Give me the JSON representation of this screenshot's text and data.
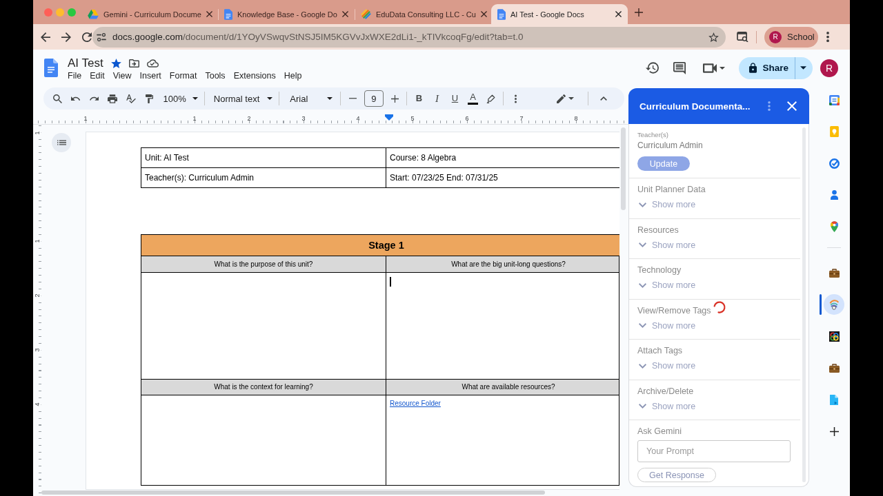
{
  "browser": {
    "tabs": [
      {
        "kind": "drive",
        "title": "Gemini - Curriculum Docume",
        "selected": false
      },
      {
        "kind": "docs",
        "title": "Knowledge Base - Google Do",
        "selected": false
      },
      {
        "kind": "edudata",
        "title": "EduData Consulting LLC - Cu",
        "selected": false
      },
      {
        "kind": "docs",
        "title": "AI Test - Google Docs",
        "selected": true
      }
    ],
    "url": {
      "host": "docs.google.com",
      "path": "/document/d/1YOyVSwqvStNSJ5IM5KGVvJxWXE2dLi1-_kTIVkcoqFg/edit?tab=t.0"
    },
    "profile": {
      "initial": "R",
      "label": "School"
    }
  },
  "document": {
    "title": "AI Test",
    "starred": true,
    "menu": [
      "File",
      "Edit",
      "View",
      "Insert",
      "Format",
      "Tools",
      "Extensions",
      "Help"
    ],
    "share": "Share",
    "avatar": "R"
  },
  "toolbar": {
    "zoom": "100%",
    "style": "Normal text",
    "font": "Arial",
    "size": "9",
    "format": [
      {
        "kind": "bold",
        "label": "B"
      },
      {
        "kind": "italic",
        "label": "I"
      },
      {
        "kind": "underline",
        "label": "U"
      },
      {
        "kind": "text_color",
        "label": "A"
      }
    ]
  },
  "ruler": {
    "horizontal": [
      "1",
      "1",
      "2",
      "3",
      "4",
      "5",
      "6",
      "7",
      "8"
    ],
    "vertical": [
      "1",
      "1",
      "2",
      "3",
      "4"
    ]
  },
  "info_table": {
    "rows": [
      [
        "Unit: AI Test",
        "Course: 8 Algebra"
      ],
      [
        "Teacher(s): Curriculum Admin",
        "Start: 07/23/25 End: 07/31/25"
      ]
    ]
  },
  "stage_table": {
    "title": "Stage 1",
    "blocks": [
      {
        "questions": [
          "What is the purpose of this unit?",
          "What are the big unit-long questions?"
        ],
        "cells": [
          {
            "cursor": false
          },
          {
            "cursor": true
          }
        ]
      },
      {
        "questions": [
          "What is the context for learning?",
          "What are available resources?"
        ],
        "cells": [
          {
            "cursor": false
          },
          {
            "cursor": false,
            "link": "Resource Folder"
          }
        ]
      }
    ]
  },
  "addon_panel": {
    "title": "Curriculum Documenta...",
    "teacher_label": "Teacher(s)",
    "teacher": "Curriculum Admin",
    "update": "Update",
    "sections": [
      {
        "title": "Unit Planner Data",
        "toggle": "Show more",
        "expanded": false,
        "loading": false
      },
      {
        "title": "Resources",
        "toggle": "Show more",
        "expanded": false,
        "loading": false
      },
      {
        "title": "Technology",
        "toggle": "Show more",
        "expanded": false,
        "loading": false
      },
      {
        "title": "View/Remove Tags",
        "toggle": "Show more",
        "expanded": false,
        "loading": true
      },
      {
        "title": "Attach Tags",
        "toggle": "Show more",
        "expanded": false,
        "loading": false
      },
      {
        "title": "Archive/Delete",
        "toggle": "Show more",
        "expanded": false,
        "loading": false
      }
    ],
    "ask": {
      "title": "Ask Gemini",
      "placeholder": "Your Prompt",
      "button": "Get Response"
    }
  },
  "side_rail": {
    "groups": [
      [
        {
          "kind": "calendar",
          "selected": false
        },
        {
          "kind": "keep",
          "selected": false
        },
        {
          "kind": "tasks",
          "selected": false
        },
        {
          "kind": "contacts",
          "selected": false
        },
        {
          "kind": "maps",
          "selected": false
        }
      ],
      [
        {
          "kind": "briefcase",
          "selected": false
        },
        {
          "kind": "addon",
          "selected": true
        },
        {
          "kind": "rings",
          "selected": false
        },
        {
          "kind": "briefcase",
          "selected": false
        },
        {
          "kind": "doc_tool",
          "selected": false
        }
      ]
    ]
  }
}
